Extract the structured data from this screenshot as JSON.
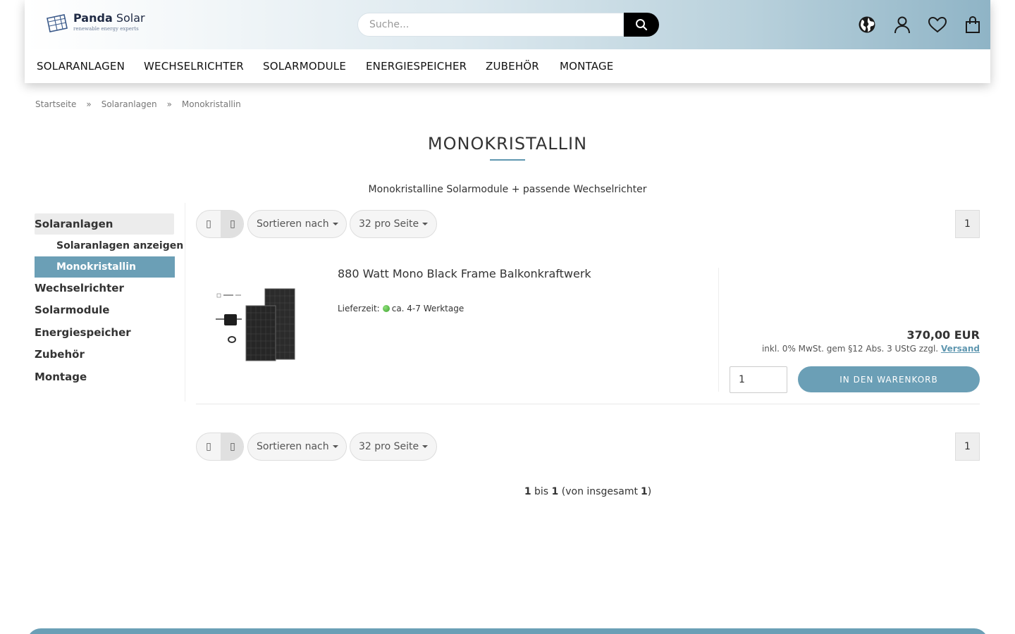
{
  "header": {
    "logo": {
      "brand_bold": "Panda",
      "brand_light": "Solar",
      "tagline": "renewable energy experts"
    },
    "search": {
      "placeholder": "Suche..."
    },
    "icons": [
      "globe-icon",
      "user-icon",
      "heart-icon",
      "cart-icon"
    ]
  },
  "nav": {
    "items": [
      "SOLARANLAGEN",
      "WECHSELRICHTER",
      "SOLARMODULE",
      "ENERGIESPEICHER",
      "ZUBEHÖR",
      "MONTAGE"
    ]
  },
  "breadcrumb": {
    "items": [
      "Startseite",
      "Solaranlagen",
      "Monokristallin"
    ],
    "separator": "»"
  },
  "page": {
    "title": "MONOKRISTALLIN",
    "description": "Monokristalline Solarmodule + passende Wechselrichter"
  },
  "sidebar": {
    "categories": [
      "Solaranlagen",
      "Wechselrichter",
      "Solarmodule",
      "Energiespeicher",
      "Zubehör",
      "Montage"
    ],
    "sub": {
      "show_all": "Solaranlagen anzeigen",
      "selected": "Monokristallin"
    }
  },
  "toolbar": {
    "sort_label": "Sortieren nach",
    "per_page_label": "32 pro Seite",
    "page": "1",
    "view_icons": [
      "grid-view-icon",
      "list-view-icon"
    ]
  },
  "product": {
    "title": "880 Watt Mono Black Frame Balkonkraftwerk",
    "delivery_label": "Lieferzeit:",
    "delivery_value": "ca. 4-7 Werktage",
    "price": "370,00 EUR",
    "vat_text": "inkl. 0% MwSt. gem §12 Abs. 3 UStG zzgl.",
    "shipping_link": "Versand",
    "quantity": "1",
    "cart_button": "IN DEN WARENKORB"
  },
  "pagination": {
    "from": "1",
    "word_to": "bis",
    "to": "1",
    "total_prefix": "(von insgesamt",
    "total": "1",
    "total_suffix": ")"
  },
  "colors": {
    "accent": "#6b9fb6",
    "nav_text": "#111111",
    "search_button": "#000000"
  }
}
